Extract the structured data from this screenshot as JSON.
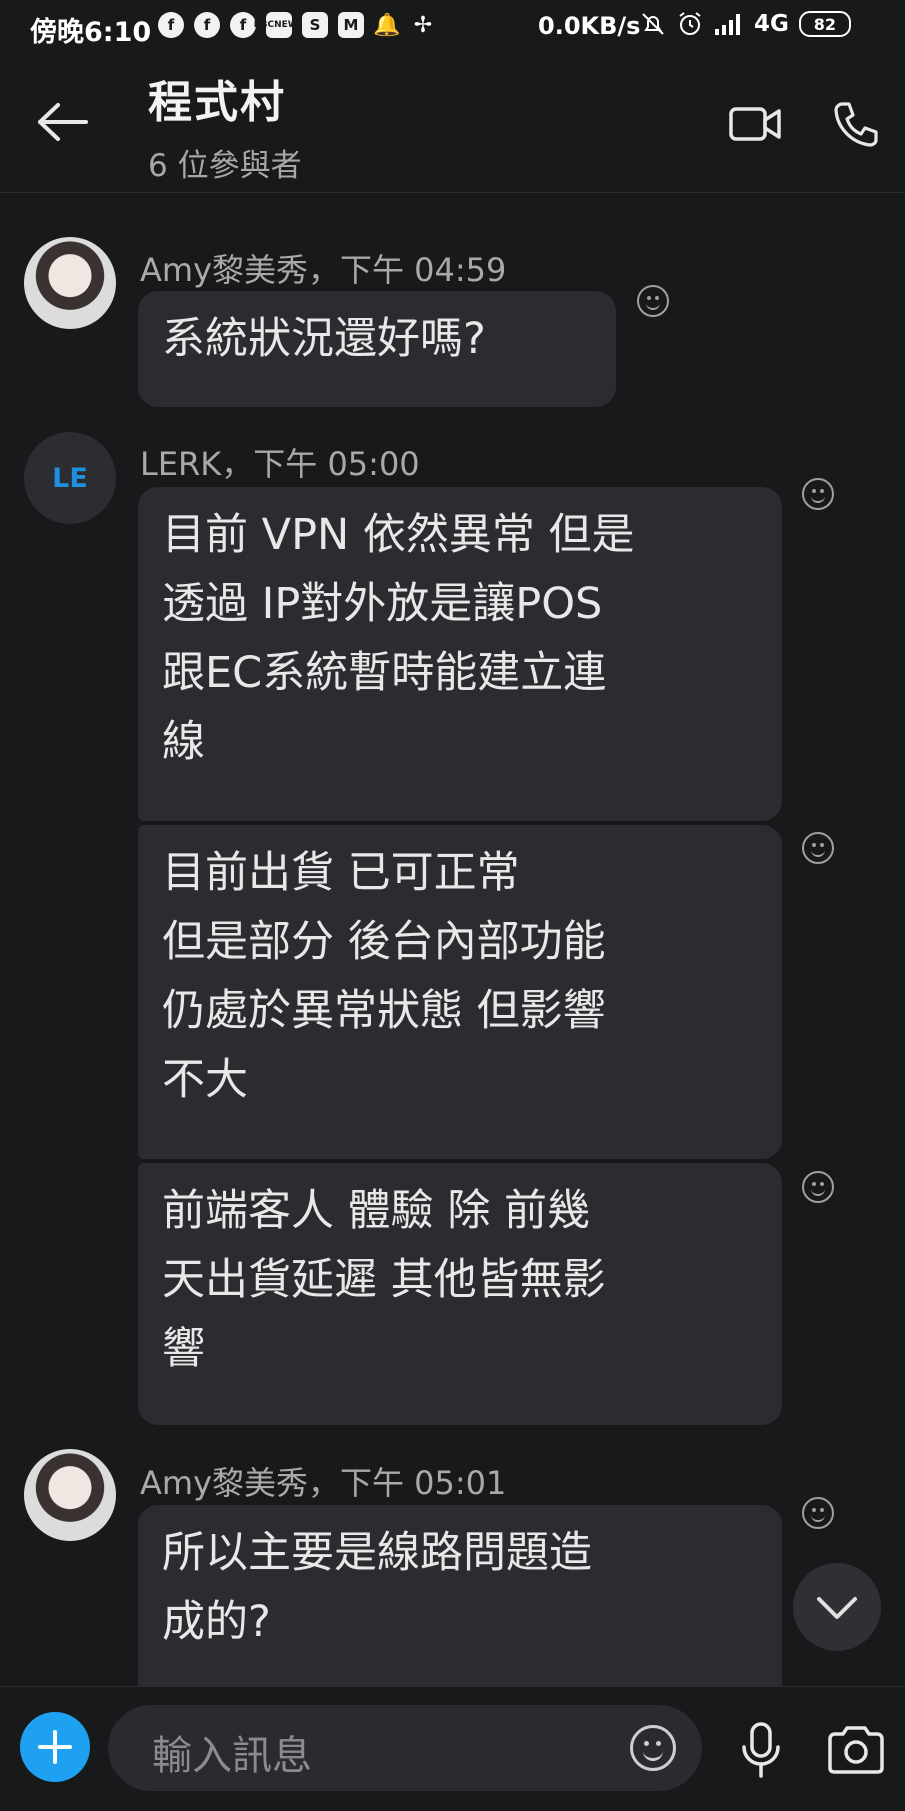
{
  "status_bar": {
    "time": "傍晚6:10",
    "app_icons": [
      "facebook-icon",
      "facebook-icon",
      "facebook-icon",
      "bbc-news-icon",
      "shopee-icon",
      "gmail-icon",
      "bell-icon",
      "pinwheel-icon"
    ],
    "bbc_line1": "BBC",
    "bbc_line2": "NEWS",
    "network_speed": "0.0KB/s",
    "network_type": "4G",
    "battery": "82"
  },
  "header": {
    "back_icon": "back-arrow-icon",
    "title": "程式村",
    "subtitle": "6 位參與者",
    "video_icon": "video-camera-icon",
    "call_icon": "phone-icon"
  },
  "messages": {
    "group1": {
      "sender_time": "Amy黎美秀，下午 04:59",
      "text": "系統狀況還好嗎?"
    },
    "group2": {
      "avatar_initials": "LE",
      "sender_time": "LERK，下午 05:00",
      "texts": [
        "目前 VPN 依然異常 但是\n透過 IP對外放是讓POS\n跟EC系統暫時能建立連\n線",
        "目前出貨 已可正常\n但是部分 後台內部功能\n仍處於異常狀態 但影響\n不大",
        "前端客人 體驗 除  前幾\n天出貨延遲 其他皆無影\n響"
      ]
    },
    "group3": {
      "sender_time": "Amy黎美秀，下午 05:01",
      "text": "所以主要是線路問題造\n成的?"
    }
  },
  "composer": {
    "placeholder": "輸入訊息",
    "plus_icon": "plus-icon",
    "emoji_icon": "emoji-icon",
    "mic_icon": "microphone-icon",
    "camera_icon": "camera-icon"
  },
  "colors": {
    "background": "#18191b",
    "bubble": "#2b2c30",
    "accent": "#1ea1f1",
    "initials": "#1f8fe0"
  }
}
